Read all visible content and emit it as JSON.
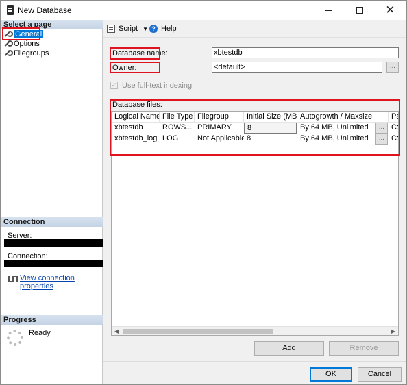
{
  "window": {
    "title": "New Database"
  },
  "left": {
    "select_page": "Select a page",
    "pages": [
      "General",
      "Options",
      "Filegroups"
    ],
    "connection_head": "Connection",
    "server_label": "Server:",
    "connection_label": "Connection:",
    "view_link": "View connection properties",
    "progress_head": "Progress",
    "status": "Ready"
  },
  "toolbar": {
    "script": "Script",
    "help": "Help"
  },
  "form": {
    "db_name_label": "Database name:",
    "db_name_value": "xbtestdb",
    "owner_label": "Owner:",
    "owner_value": "<default>",
    "browse": "...",
    "fulltext_label": "Use full-text indexing"
  },
  "files": {
    "label": "Database files:",
    "columns": [
      "Logical Name",
      "File Type",
      "Filegroup",
      "Initial Size (MB)",
      "Autogrowth / Maxsize",
      "Pa"
    ],
    "rows": [
      [
        "xbtestdb",
        "ROWS...",
        "PRIMARY",
        "8",
        "By 64 MB, Unlimited",
        "C:"
      ],
      [
        "xbtestdb_log",
        "LOG",
        "Not Applicable",
        "8",
        "By 64 MB, Unlimited",
        "C:"
      ]
    ]
  },
  "buttons": {
    "add": "Add",
    "remove": "Remove",
    "ok": "OK",
    "cancel": "Cancel"
  }
}
